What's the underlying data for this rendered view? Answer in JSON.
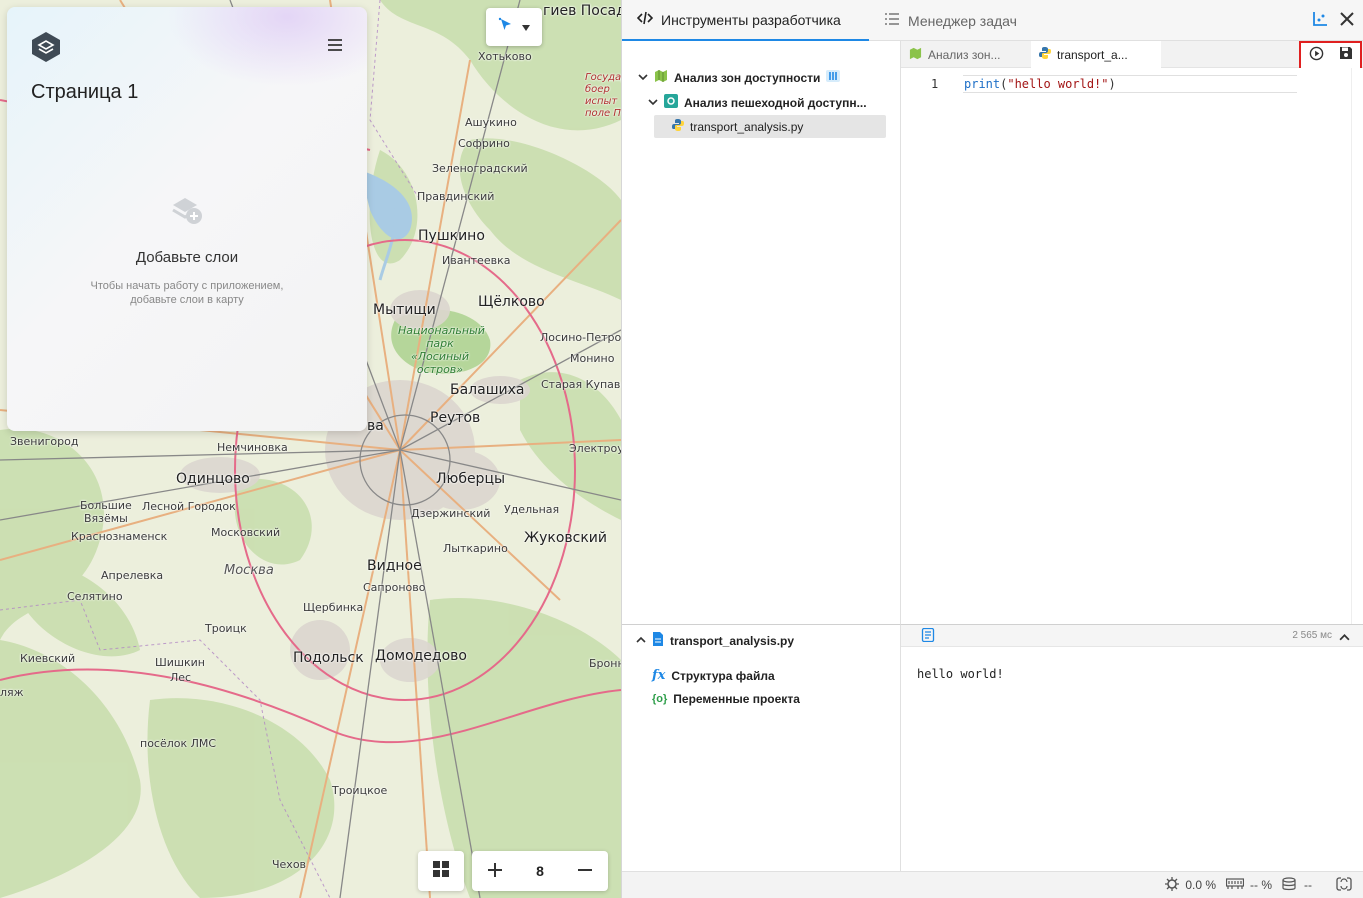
{
  "map": {
    "tool_button": {
      "icon": "cursor-arrow-icon",
      "dropdown": "chevron-down-icon"
    },
    "zoom_level": "8",
    "places": [
      {
        "name": "Хотьково",
        "cls": "small"
      },
      {
        "name": "гиев Посад",
        "cls": "big"
      },
      {
        "name": "Ашукино",
        "cls": "small"
      },
      {
        "name": "Софрино",
        "cls": "small"
      },
      {
        "name": "Зеленоградский",
        "cls": "small"
      },
      {
        "name": "Правдинский",
        "cls": "small"
      },
      {
        "name": "Пушкино",
        "cls": "big"
      },
      {
        "name": "Ивантеевка",
        "cls": "small"
      },
      {
        "name": "Мытищи",
        "cls": "big"
      },
      {
        "name": "Щёлково",
        "cls": "big"
      },
      {
        "name": "Лосино-Петров",
        "cls": "small"
      },
      {
        "name": "Монино",
        "cls": "small"
      },
      {
        "name": "Балашиха",
        "cls": "big"
      },
      {
        "name": "Старая Купавн",
        "cls": "small"
      },
      {
        "name": "Реутов",
        "cls": "big"
      },
      {
        "name": "ва",
        "cls": "big"
      },
      {
        "name": "Электроу",
        "cls": "small"
      },
      {
        "name": "Звенигород",
        "cls": "small"
      },
      {
        "name": "Немчиновка",
        "cls": "small"
      },
      {
        "name": "Одинцово",
        "cls": "big"
      },
      {
        "name": "Люберцы",
        "cls": "big"
      },
      {
        "name": "Большие",
        "cls": "small"
      },
      {
        "name": "Вязёмы",
        "cls": "small"
      },
      {
        "name": "Лесной Городок",
        "cls": "small"
      },
      {
        "name": "Дзержинский",
        "cls": "small"
      },
      {
        "name": "Удельная",
        "cls": "small"
      },
      {
        "name": "Краснознаменск",
        "cls": "small"
      },
      {
        "name": "Московский",
        "cls": "small"
      },
      {
        "name": "Жуковский",
        "cls": "big"
      },
      {
        "name": "Лыткарино",
        "cls": "small"
      },
      {
        "name": "Апрелевка",
        "cls": "small"
      },
      {
        "name": "Москва",
        "cls": "ital"
      },
      {
        "name": "Видное",
        "cls": "big"
      },
      {
        "name": "Сапроново",
        "cls": "small"
      },
      {
        "name": "Селятино",
        "cls": "small"
      },
      {
        "name": "Щербинка",
        "cls": "small"
      },
      {
        "name": "Троицк",
        "cls": "small"
      },
      {
        "name": "Подольск",
        "cls": "big"
      },
      {
        "name": "Домодедово",
        "cls": "big"
      },
      {
        "name": "Киевский",
        "cls": "small"
      },
      {
        "name": "Шишкин",
        "cls": "small"
      },
      {
        "name": "Лес",
        "cls": "small"
      },
      {
        "name": "Бронн",
        "cls": "small"
      },
      {
        "name": "ляж",
        "cls": "small"
      },
      {
        "name": "посёлок ЛМС",
        "cls": "small"
      },
      {
        "name": "Троицкое",
        "cls": "small"
      },
      {
        "name": "Чехов",
        "cls": "small"
      }
    ],
    "park_label": "Национальный парк «Лосиный остров»",
    "red_label": "Государ боер испыт поле П"
  },
  "panel": {
    "title": "Страница 1",
    "empty_title": "Добавьте слои",
    "empty_subtitle": "Чтобы начать работу с приложением, добавьте слои в карту"
  },
  "devtools": {
    "tab_active": "Инструменты разработчика",
    "tab_inactive": "Менеджер задач",
    "tree": {
      "project": "Анализ зон доступности",
      "folder": "Анализ пешеходной доступн...",
      "file": "transport_analysis.py"
    },
    "editor_tabs": [
      "Анализ зон...",
      "transport_a..."
    ],
    "line_numbers": [
      "1"
    ],
    "code": {
      "fn": "print",
      "open": "(",
      "str": "\"hello world!\"",
      "close": ")"
    },
    "bottom": {
      "file": "transport_analysis.py",
      "items": [
        "Структура файла",
        "Переменные проекта"
      ]
    },
    "output": {
      "timing": "2 565 мс",
      "text": "hello world!"
    },
    "status": {
      "cpu": "0.0 %",
      "memory": "-- %",
      "db": "--"
    }
  },
  "colors": {
    "accent": "#1e88e5",
    "highlight_border": "#e02020",
    "map_green": "#c5dcaa"
  }
}
